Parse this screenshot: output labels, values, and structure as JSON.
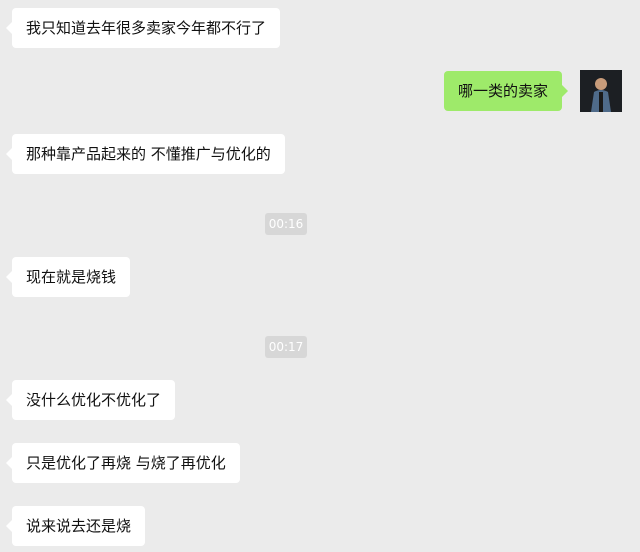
{
  "conversation": {
    "messages": [
      {
        "side": "left",
        "text": "我只知道去年很多卖家今年都不行了"
      },
      {
        "side": "right",
        "text": "哪一类的卖家"
      },
      {
        "side": "left",
        "text": "那种靠产品起来的 不懂推广与优化的"
      },
      {
        "type": "timestamp",
        "text": "00:16"
      },
      {
        "side": "left",
        "text": "现在就是烧钱"
      },
      {
        "type": "timestamp",
        "text": "00:17"
      },
      {
        "side": "left",
        "text": "没什么优化不优化了"
      },
      {
        "side": "left",
        "text": "只是优化了再烧 与烧了再优化"
      },
      {
        "side": "left",
        "text": "说来说去还是烧"
      }
    ]
  },
  "colors": {
    "background": "#ebebeb",
    "left_bubble": "#ffffff",
    "right_bubble": "#9eea6a",
    "timestamp_bg": "#d7d7d7",
    "timestamp_text": "#ffffff"
  },
  "icons": {
    "avatar": "user-avatar-icon"
  }
}
